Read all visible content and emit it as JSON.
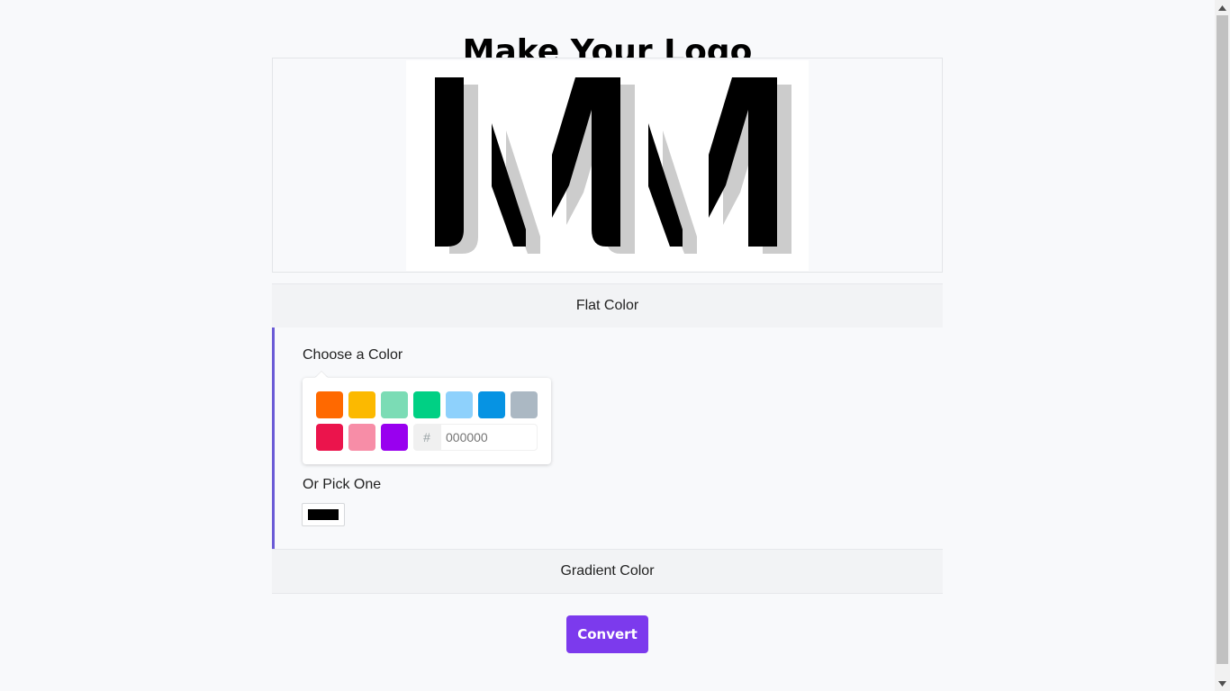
{
  "page": {
    "title": "Make Your Logo"
  },
  "logo": {
    "fill": "#000000",
    "shadow": "#cccccc",
    "background": "#ffffff"
  },
  "tabs": {
    "flat_label": "Flat Color",
    "gradient_label": "Gradient Color"
  },
  "flat": {
    "choose_label": "Choose a Color",
    "swatches": [
      "#ff6900",
      "#fcb900",
      "#7bdcb5",
      "#00d084",
      "#8ed1fc",
      "#0693e3",
      "#abb8c3",
      "#eb144c",
      "#f78da7",
      "#9900ef"
    ],
    "hash_symbol": "#",
    "hex_placeholder": "000000",
    "pick_label": "Or Pick One",
    "picked_color": "#000000"
  },
  "actions": {
    "convert_label": "Convert"
  },
  "accent": "#7c3aed"
}
